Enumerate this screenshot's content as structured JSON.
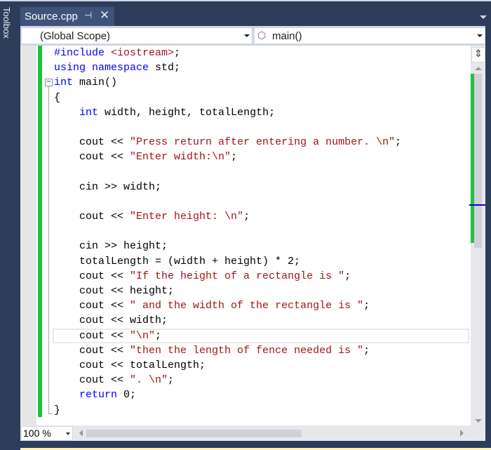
{
  "toolbox": {
    "label": "Toolbox"
  },
  "tab": {
    "name": "Source.cpp",
    "pin_icon": "pin-icon",
    "close_icon": "close-icon"
  },
  "navbar": {
    "scope": "(Global Scope)",
    "member": "main()",
    "member_icon": "method-cube-icon"
  },
  "zoom": {
    "value": "100 %"
  },
  "colors": {
    "keyword": "#0000ff",
    "string": "#a31515",
    "plain": "#000000",
    "change_bar": "#1fc13d",
    "chrome": "#2d3c59"
  },
  "current_line": 19,
  "code": [
    [
      {
        "t": "#include ",
        "c": "kw"
      },
      {
        "t": "<iostream>",
        "c": "str"
      },
      {
        "t": ";",
        "c": "plain"
      }
    ],
    [
      {
        "t": "using namespace ",
        "c": "kw"
      },
      {
        "t": "std;",
        "c": "plain"
      }
    ],
    [
      {
        "t": "int ",
        "c": "kw"
      },
      {
        "t": "main()",
        "c": "plain"
      }
    ],
    [
      {
        "t": "{",
        "c": "plain"
      }
    ],
    [
      {
        "t": "    ",
        "c": "plain"
      },
      {
        "t": "int ",
        "c": "kw"
      },
      {
        "t": "width, height, totalLength;",
        "c": "plain"
      }
    ],
    [],
    [
      {
        "t": "    cout << ",
        "c": "plain"
      },
      {
        "t": "\"Press return after entering a number. \\n\"",
        "c": "str"
      },
      {
        "t": ";",
        "c": "plain"
      }
    ],
    [
      {
        "t": "    cout << ",
        "c": "plain"
      },
      {
        "t": "\"Enter width:\\n\"",
        "c": "str"
      },
      {
        "t": ";",
        "c": "plain"
      }
    ],
    [],
    [
      {
        "t": "    cin >> width;",
        "c": "plain"
      }
    ],
    [],
    [
      {
        "t": "    cout << ",
        "c": "plain"
      },
      {
        "t": "\"Enter height: \\n\"",
        "c": "str"
      },
      {
        "t": ";",
        "c": "plain"
      }
    ],
    [],
    [
      {
        "t": "    cin >> height;",
        "c": "plain"
      }
    ],
    [
      {
        "t": "    totalLength = (width + height) * 2;",
        "c": "plain"
      }
    ],
    [
      {
        "t": "    cout << ",
        "c": "plain"
      },
      {
        "t": "\"If the height of a rectangle is \"",
        "c": "str"
      },
      {
        "t": ";",
        "c": "plain"
      }
    ],
    [
      {
        "t": "    cout << height;",
        "c": "plain"
      }
    ],
    [
      {
        "t": "    cout << ",
        "c": "plain"
      },
      {
        "t": "\" and the width of the rectangle is \"",
        "c": "str"
      },
      {
        "t": ";",
        "c": "plain"
      }
    ],
    [
      {
        "t": "    cout << width;",
        "c": "plain"
      }
    ],
    [
      {
        "t": "    cout << ",
        "c": "plain"
      },
      {
        "t": "\"\\n\"",
        "c": "str"
      },
      {
        "t": ";",
        "c": "plain"
      }
    ],
    [
      {
        "t": "    cout << ",
        "c": "plain"
      },
      {
        "t": "\"then the length of fence needed is \"",
        "c": "str"
      },
      {
        "t": ";",
        "c": "plain"
      }
    ],
    [
      {
        "t": "    cout << totalLength;",
        "c": "plain"
      }
    ],
    [
      {
        "t": "    cout << ",
        "c": "plain"
      },
      {
        "t": "\". \\n\"",
        "c": "str"
      },
      {
        "t": ";",
        "c": "plain"
      }
    ],
    [
      {
        "t": "    ",
        "c": "plain"
      },
      {
        "t": "return ",
        "c": "kw"
      },
      {
        "t": "0;",
        "c": "plain"
      }
    ],
    [
      {
        "t": "}",
        "c": "plain"
      }
    ]
  ]
}
